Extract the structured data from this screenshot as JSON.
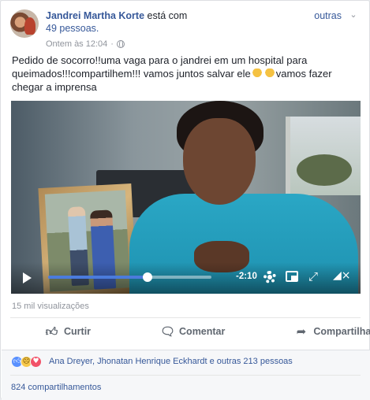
{
  "post": {
    "author": "Jandrei Martha Korte",
    "author_suffix": "está com",
    "others_link": "outras",
    "people": "49 pessoas.",
    "timestamp": "Ontem às 12:04",
    "separator": "·",
    "text_part1": "Pedido de socorro!!uma vaga para o jandrei em um hospital para queimados!!!compartilhem!!! vamos juntos salvar ele",
    "text_part2": "vamos fazer chegar a imprensa"
  },
  "video": {
    "time": "-2:10",
    "progress": 0.61
  },
  "views": "15 mil visualizações",
  "actions": {
    "like": "Curtir",
    "comment": "Comentar",
    "share": "Compartilhar"
  },
  "reactions": {
    "types": [
      "like-icon",
      "sad-icon",
      "love-icon"
    ],
    "reactors": "Ana Dreyer, Jhonatan Henrique Eckhardt e outras 213 pessoas",
    "shares": "824 compartilhamentos"
  },
  "colors": {
    "link": "#365899",
    "meta": "#90949c",
    "seek": "#4b7bdc"
  }
}
